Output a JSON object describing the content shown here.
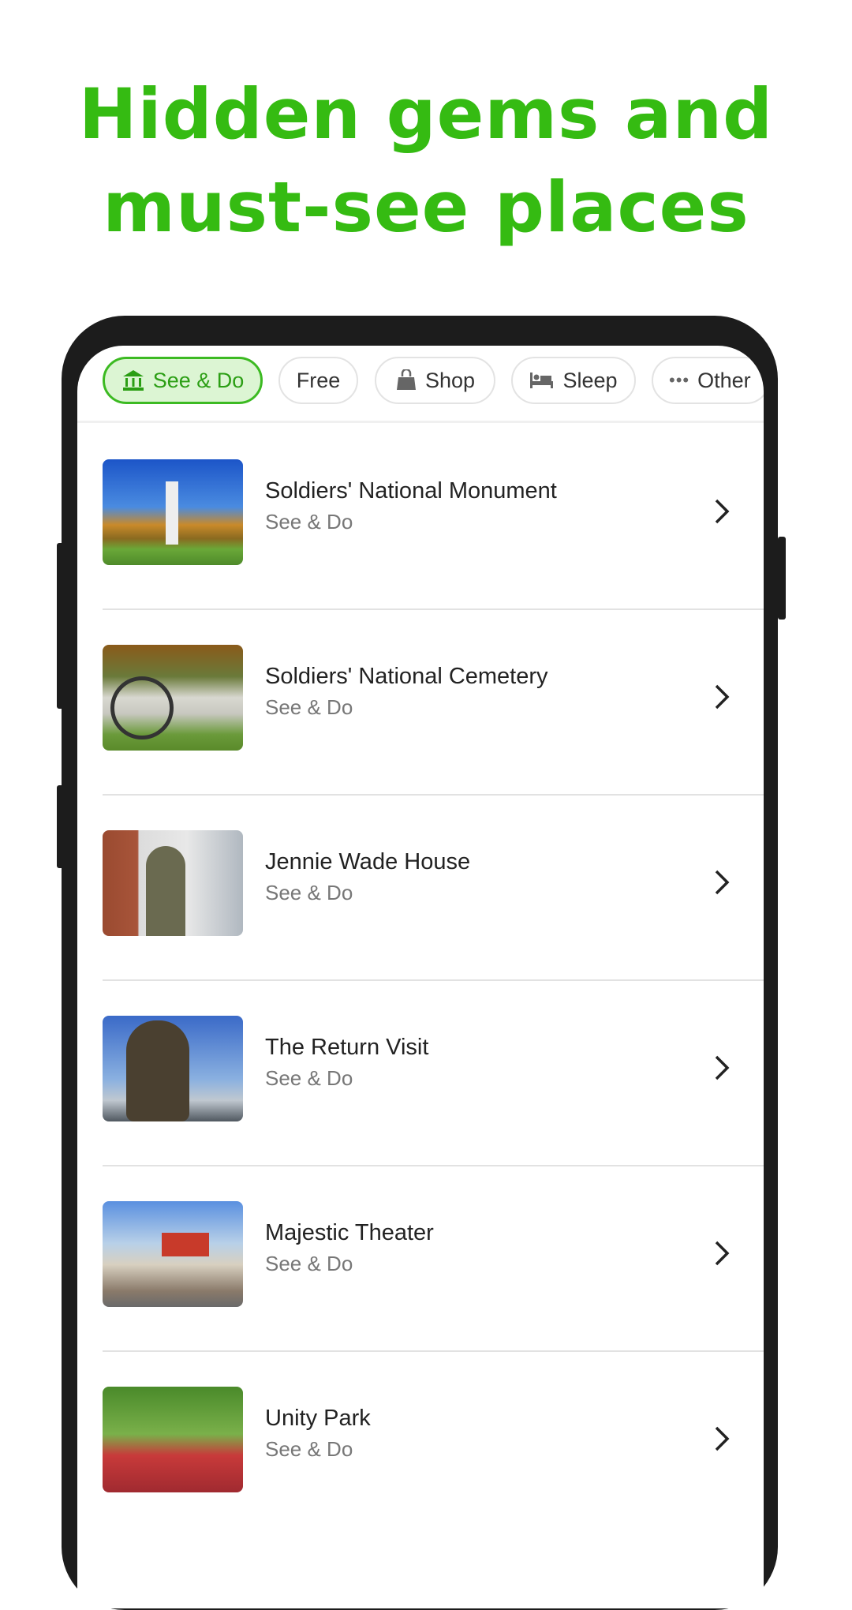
{
  "headline": {
    "line1": "Hidden gems and",
    "line2": "must-see places"
  },
  "accent_color": "#35bb12",
  "filters": [
    {
      "label": "See & Do",
      "icon": "museum-icon",
      "active": true
    },
    {
      "label": "Free",
      "icon": "",
      "active": false
    },
    {
      "label": "Shop",
      "icon": "shopping-bag-icon",
      "active": false
    },
    {
      "label": "Sleep",
      "icon": "bed-icon",
      "active": false
    },
    {
      "label": "Other",
      "icon": "more-dots-icon",
      "active": false
    }
  ],
  "places": [
    {
      "title": "Soldiers' National Monument",
      "category": "See & Do"
    },
    {
      "title": "Soldiers' National Cemetery",
      "category": "See & Do"
    },
    {
      "title": "Jennie Wade House",
      "category": "See & Do"
    },
    {
      "title": "The Return Visit",
      "category": "See & Do"
    },
    {
      "title": "Majestic Theater",
      "category": "See & Do"
    },
    {
      "title": "Unity Park",
      "category": "See & Do"
    }
  ]
}
